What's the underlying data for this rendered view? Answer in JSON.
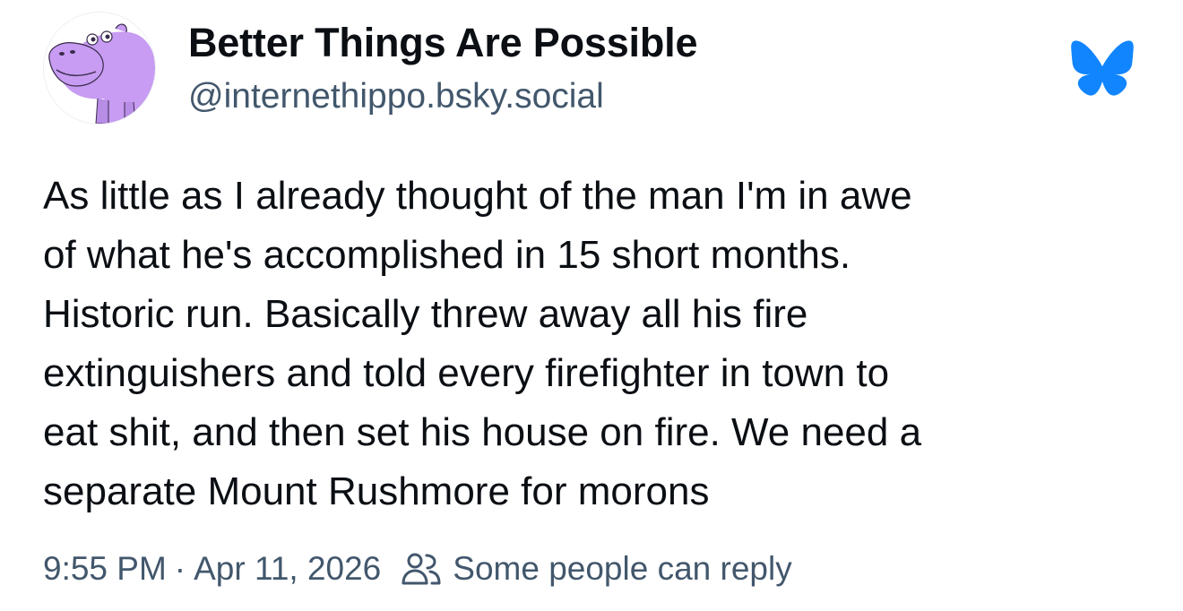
{
  "post": {
    "author": {
      "display_name": "Better Things Are Possible",
      "handle": "@internethippo.bsky.social",
      "avatar_icon": "purple-hippo-avatar"
    },
    "platform_icon": "bluesky-butterfly-icon",
    "text": "As little as I already thought of the man I'm in awe\nof what he's accomplished in 15 short months.\nHistoric run. Basically threw away all his fire\nextinguishers and told every firefighter in town to\neat shit, and then set his house on fire. We need a\nseparate Mount Rushmore for morons",
    "time": "9:55 PM",
    "separator": "·",
    "date": "Apr 11, 2026",
    "reply_icon": "people-icon",
    "reply_setting": "Some people can reply"
  },
  "colors": {
    "text": "#0b0f14",
    "secondary_text": "#42576c",
    "bluesky_blue": "#1185fe",
    "hippo_purple": "#c79cf2"
  }
}
